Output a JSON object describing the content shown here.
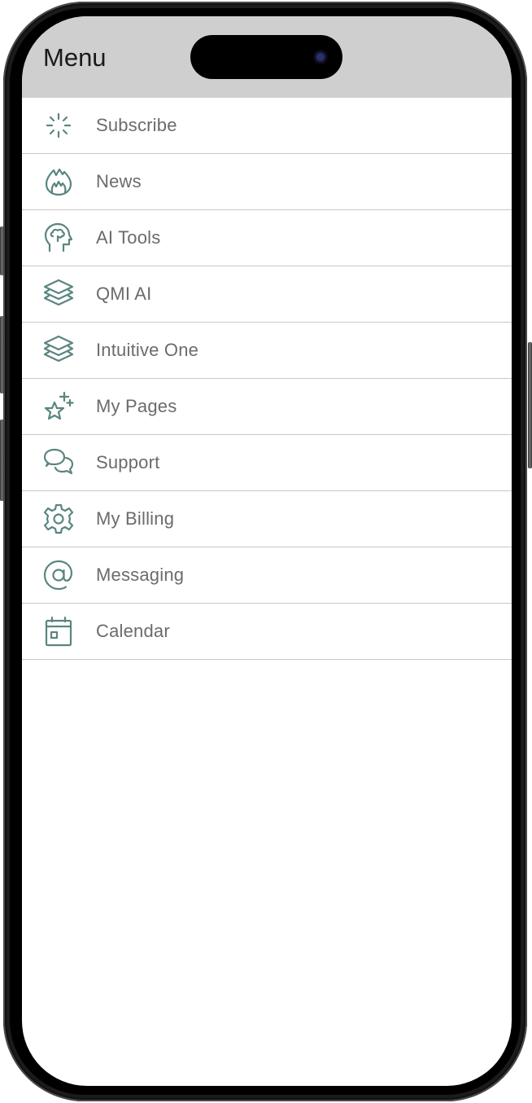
{
  "header": {
    "title": "Menu"
  },
  "theme": {
    "icon_color": "#5a8580",
    "label_color": "#6b6b6b",
    "header_bg": "#cfcfcf",
    "divider": "#c8c8c8"
  },
  "menu": {
    "items": [
      {
        "label": "Subscribe",
        "icon": "loader-icon"
      },
      {
        "label": "News",
        "icon": "flame-icon"
      },
      {
        "label": "AI Tools",
        "icon": "brain-head-icon"
      },
      {
        "label": "QMI AI",
        "icon": "layers-icon"
      },
      {
        "label": "Intuitive One",
        "icon": "layers-icon"
      },
      {
        "label": "My Pages",
        "icon": "star-sparkle-icon"
      },
      {
        "label": "Support",
        "icon": "chat-bubbles-icon"
      },
      {
        "label": "My Billing",
        "icon": "gear-icon"
      },
      {
        "label": "Messaging",
        "icon": "at-sign-icon"
      },
      {
        "label": "Calendar",
        "icon": "calendar-icon"
      }
    ]
  }
}
